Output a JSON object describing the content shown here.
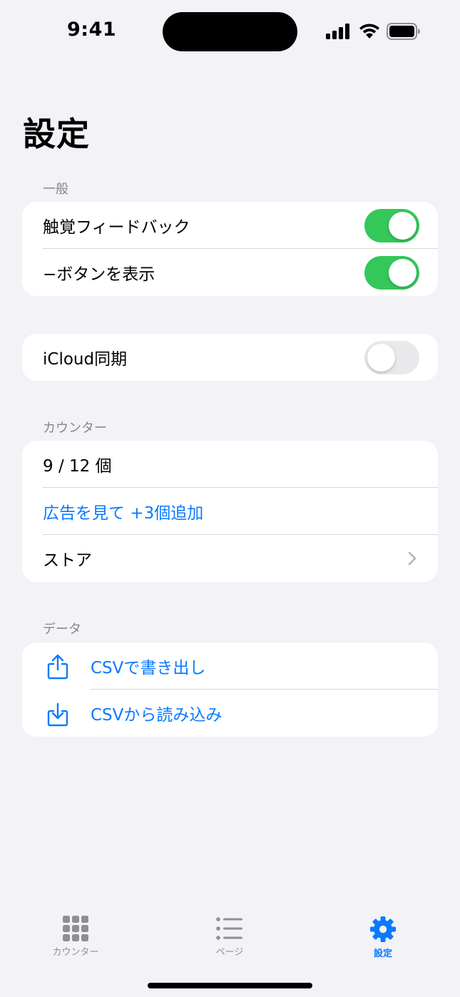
{
  "status_bar": {
    "time": "9:41"
  },
  "title": "設定",
  "sections": {
    "general": {
      "header": "一般",
      "haptics_label": "触覚フィードバック",
      "haptics_on": true,
      "minus_button_label": "−ボタンを表示",
      "minus_button_on": true
    },
    "sync": {
      "icloud_label": "iCloud同期",
      "icloud_on": false
    },
    "counter": {
      "header": "カウンター",
      "count_text": "9 / 12 個",
      "watch_ad_label": "広告を見て +3個追加",
      "store_label": "ストア"
    },
    "data": {
      "header": "データ",
      "export_label": "CSVで書き出し",
      "import_label": "CSVから読み込み"
    }
  },
  "tab_bar": {
    "tabs": [
      {
        "label": "カウンター",
        "icon": "grid-icon",
        "active": false
      },
      {
        "label": "ページ",
        "icon": "list-icon",
        "active": false
      },
      {
        "label": "設定",
        "icon": "gear-icon",
        "active": true
      }
    ]
  },
  "colors": {
    "accent": "#0a7aff",
    "toggle_on": "#34c759",
    "toggle_off": "#e9e9eb",
    "background": "#f2f2f7"
  }
}
